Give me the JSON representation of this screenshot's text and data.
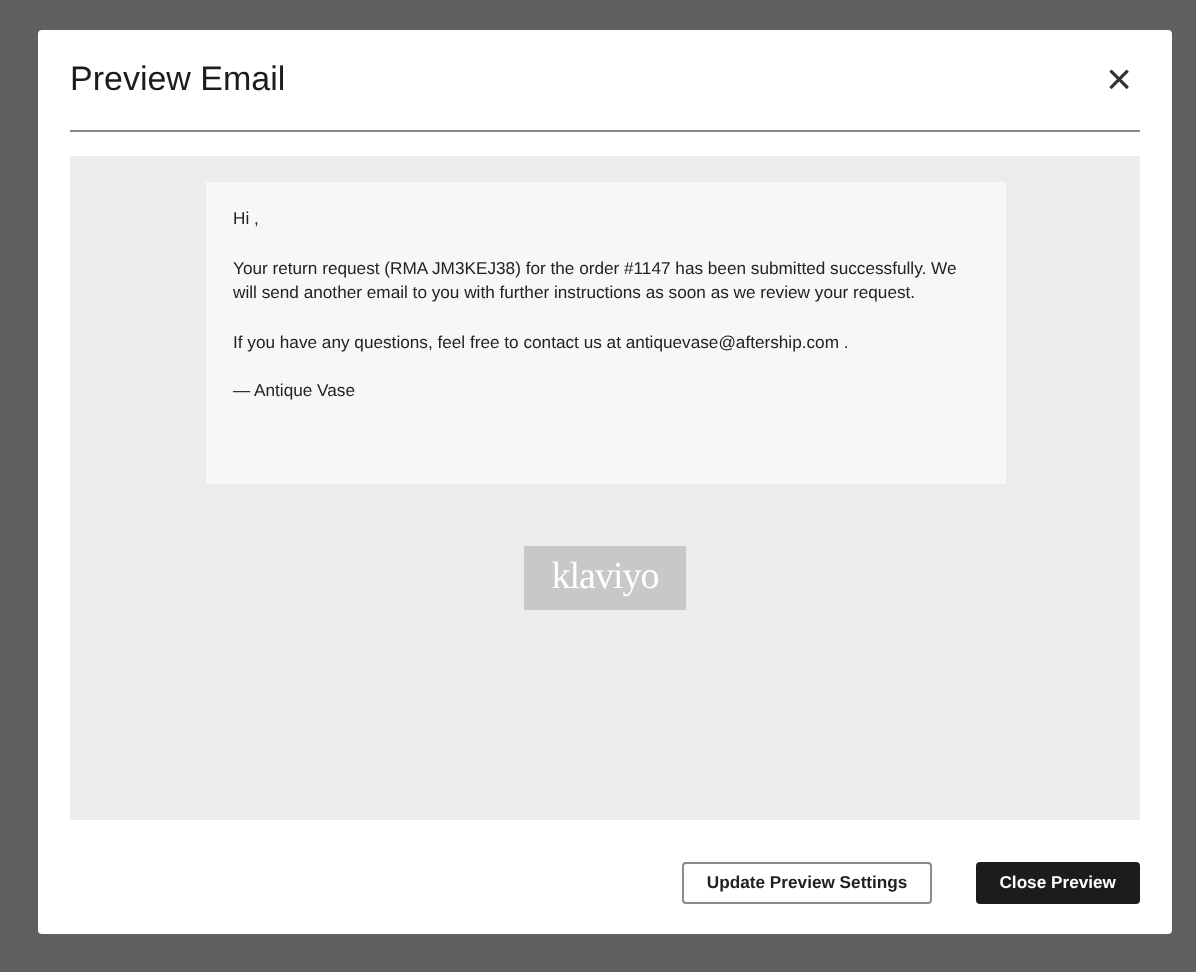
{
  "dialog": {
    "title": "Preview Email",
    "close": "×"
  },
  "email": {
    "paragraphs": [
      "Hi ,",
      "Your return request (RMA JM3KEJ38) for the order #1147 has been submitted successfully. We will send another email to you with further instructions as soon as we review your request.",
      "If you have any questions, feel free to contact us at antiquevase@aftership.com .",
      "— Antique Vase"
    ],
    "logo": "klaviyo"
  },
  "buttons": [
    {
      "label": "Update Preview Settings",
      "kind": "secondary"
    },
    {
      "label": "Close Preview",
      "kind": "primary"
    }
  ]
}
